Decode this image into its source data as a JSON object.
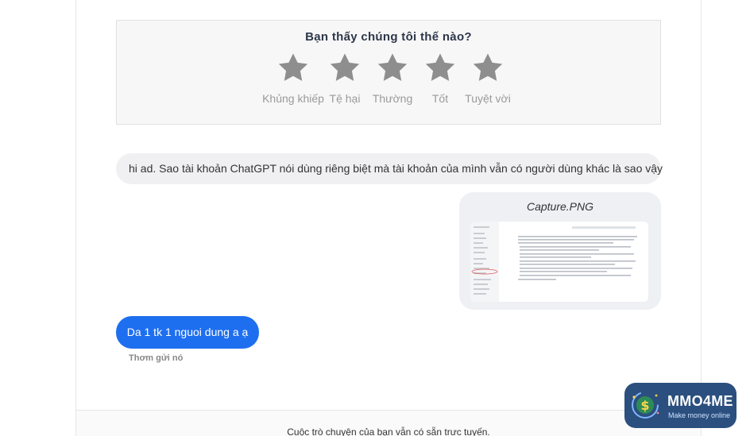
{
  "rating": {
    "title": "Bạn thấy chúng tôi thế nào?",
    "options": [
      "Khủng khiếp",
      "Tệ hại",
      "Thường",
      "Tốt",
      "Tuyệt vời"
    ],
    "star_color": "#8e8e8e"
  },
  "messages": {
    "incoming_text": "hi ad. Sao tài khoản ChatGPT nói dùng riêng biệt mà tài khoản của mình vẫn có người dùng khác là sao vậy",
    "attachment_name": "Capture.PNG",
    "outgoing_text": "Da 1 tk 1 nguoi dung a ạ",
    "sender_name": "Thơm gửi nó"
  },
  "footer": {
    "status_text": "Cuộc trò chuyện của bạn vẫn có sẵn trực tuyến."
  },
  "brand": {
    "name": "MMO4ME",
    "tagline": "Make money online"
  },
  "colors": {
    "accent": "#1e6ff0",
    "bubble_bg": "#f0f0f2",
    "brand_bg": "#2b4f7e"
  }
}
